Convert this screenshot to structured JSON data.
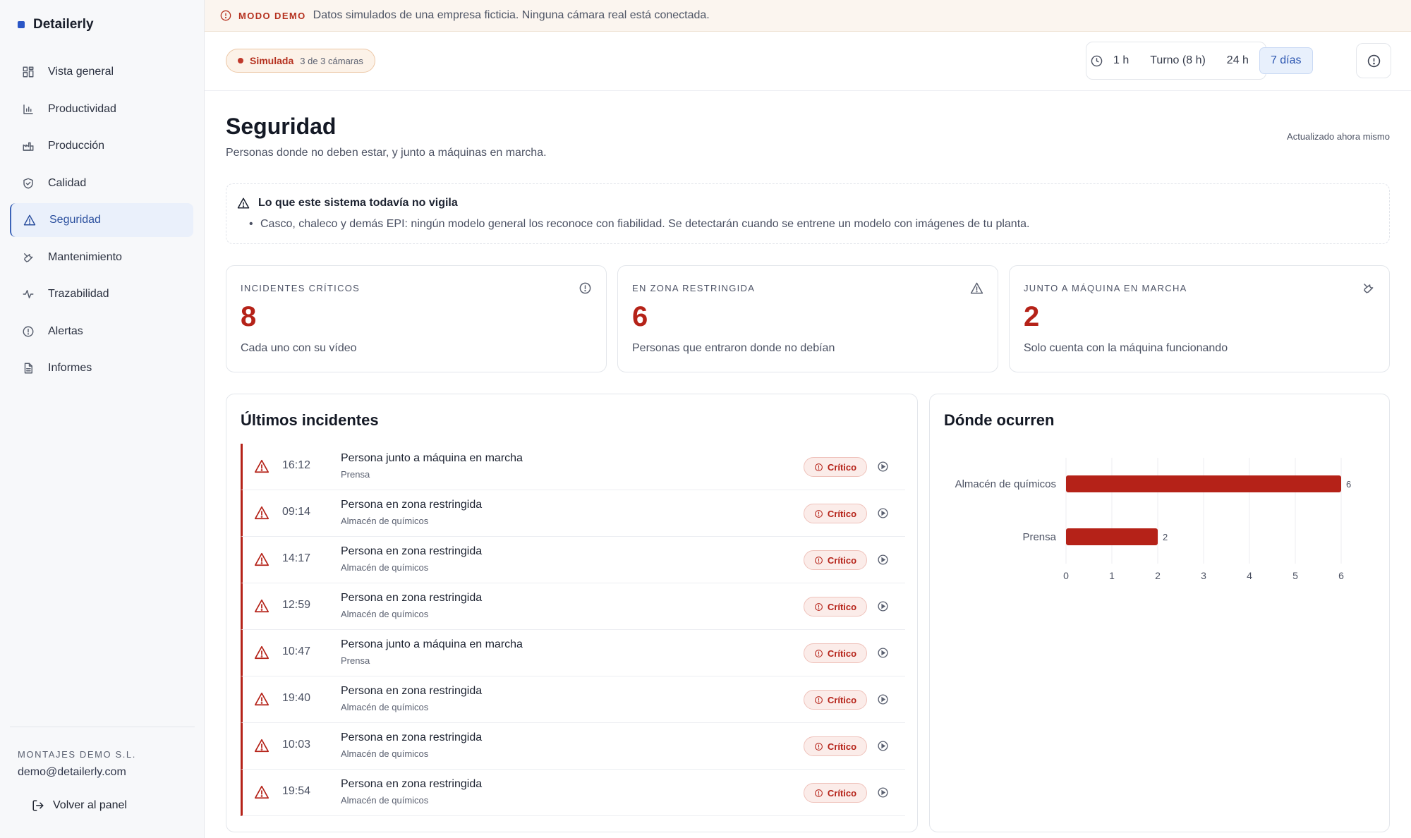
{
  "app": {
    "brand": "Detailerly"
  },
  "sidebar": {
    "items": [
      {
        "label": "Vista general",
        "icon": "grid-icon"
      },
      {
        "label": "Productividad",
        "icon": "bar-chart-icon"
      },
      {
        "label": "Producción",
        "icon": "factory-icon"
      },
      {
        "label": "Calidad",
        "icon": "shield-check-icon"
      },
      {
        "label": "Seguridad",
        "icon": "warning-icon",
        "active": true
      },
      {
        "label": "Mantenimiento",
        "icon": "wrench-icon"
      },
      {
        "label": "Trazabilidad",
        "icon": "pulse-icon"
      },
      {
        "label": "Alertas",
        "icon": "alert-circle-icon"
      },
      {
        "label": "Informes",
        "icon": "document-icon"
      }
    ],
    "company": "MONTAJES DEMO S.L.",
    "email": "demo@detailerly.com",
    "back_label": "Volver al panel"
  },
  "banner": {
    "tag": "MODO DEMO",
    "text": "Datos simulados de una empresa ficticia. Ninguna cámara real está conectada."
  },
  "topbar": {
    "status_label": "Simulada",
    "camera_count": "3 de 3 cámaras",
    "ranges": [
      "1 h",
      "Turno (8 h)",
      "24 h",
      "7 días"
    ],
    "active_range": "7 días"
  },
  "page": {
    "title": "Seguridad",
    "subtitle": "Personas donde no deben estar, y junto a máquinas en marcha.",
    "updated": "Actualizado ahora mismo"
  },
  "notice": {
    "title": "Lo que este sistema todavía no vigila",
    "items": [
      "Casco, chaleco y demás EPI: ningún modelo general los reconoce con fiabilidad. Se detectarán cuando se entrene un modelo con imágenes de tu planta."
    ]
  },
  "kpis": [
    {
      "label": "Incidentes críticos",
      "value": "8",
      "desc": "Cada uno con su vídeo",
      "icon": "alert-circle-icon"
    },
    {
      "label": "En zona restringida",
      "value": "6",
      "desc": "Personas que entraron donde no debían",
      "icon": "warning-icon"
    },
    {
      "label": "Junto a máquina en marcha",
      "value": "2",
      "desc": "Solo cuenta con la máquina funcionando",
      "icon": "wrench-icon"
    }
  ],
  "incidents": {
    "title": "Últimos incidentes",
    "badge_label": "Crítico",
    "rows": [
      {
        "time": "16:12",
        "title": "Persona junto a máquina en marcha",
        "location": "Prensa"
      },
      {
        "time": "09:14",
        "title": "Persona en zona restringida",
        "location": "Almacén de químicos"
      },
      {
        "time": "14:17",
        "title": "Persona en zona restringida",
        "location": "Almacén de químicos"
      },
      {
        "time": "12:59",
        "title": "Persona en zona restringida",
        "location": "Almacén de químicos"
      },
      {
        "time": "10:47",
        "title": "Persona junto a máquina en marcha",
        "location": "Prensa"
      },
      {
        "time": "19:40",
        "title": "Persona en zona restringida",
        "location": "Almacén de químicos"
      },
      {
        "time": "10:03",
        "title": "Persona en zona restringida",
        "location": "Almacén de químicos"
      },
      {
        "time": "19:54",
        "title": "Persona en zona restringida",
        "location": "Almacén de químicos"
      }
    ]
  },
  "where": {
    "title": "Dónde ocurren"
  },
  "chart_data": {
    "type": "bar",
    "orientation": "horizontal",
    "categories": [
      "Almacén de químicos",
      "Prensa"
    ],
    "values": [
      6,
      2
    ],
    "xlim": [
      0,
      6
    ],
    "xticks": [
      0,
      1,
      2,
      3,
      4,
      5,
      6
    ],
    "grid": true,
    "bar_color": "#b52218"
  },
  "colors": {
    "accent": "#2b55b0",
    "critical": "#b52218",
    "demo": "#b5311f"
  }
}
